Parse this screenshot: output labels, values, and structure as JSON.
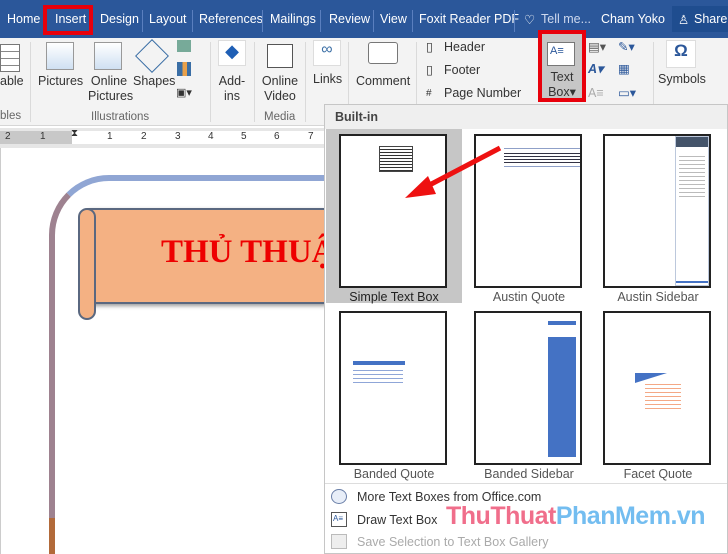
{
  "tabs": [
    "Home",
    "Insert",
    "Design",
    "Layout",
    "References",
    "Mailings",
    "Review",
    "View",
    "Foxit Reader PDF"
  ],
  "tell_me": "Tell me...",
  "user": "Cham Yoko",
  "share": "Share",
  "ribbon": {
    "table_label": "able",
    "tables_group": "bles",
    "pictures": "Pictures",
    "online_pictures_1": "Online",
    "online_pictures_2": "Pictures",
    "shapes": "Shapes",
    "illustrations_group": "Illustrations",
    "addins_1": "Add-",
    "addins_2": "ins",
    "online_video_1": "Online",
    "online_video_2": "Video",
    "media_group": "Media",
    "links": "Links",
    "comment": "Comment",
    "header": "Header",
    "footer": "Footer",
    "page_number": "Page Number",
    "text_box_1": "Text",
    "text_box_2": "Box",
    "symbols": "Symbols",
    "omega": "Ω"
  },
  "ruler": [
    "2",
    "1",
    "1",
    "2",
    "3",
    "4",
    "5",
    "6",
    "7"
  ],
  "document": {
    "banner_text": "THỦ THUẬ"
  },
  "gallery": {
    "section": "Built-in",
    "items": [
      {
        "label": "Simple Text Box"
      },
      {
        "label": "Austin Quote"
      },
      {
        "label": "Austin Sidebar"
      },
      {
        "label": "Banded Quote"
      },
      {
        "label": "Banded Sidebar"
      },
      {
        "label": "Facet Quote"
      }
    ],
    "menu": [
      {
        "label": "More Text Boxes from Office.com"
      },
      {
        "label": "Draw Text Box"
      },
      {
        "label": "Save Selection to Text Box Gallery"
      }
    ]
  },
  "watermark": {
    "part1": "ThuThuat",
    "part2": "PhanMem.vn"
  },
  "colors": {
    "accent": "#2b579a",
    "highlight": "#e8000b",
    "thumb_blue": "#4472c4"
  }
}
